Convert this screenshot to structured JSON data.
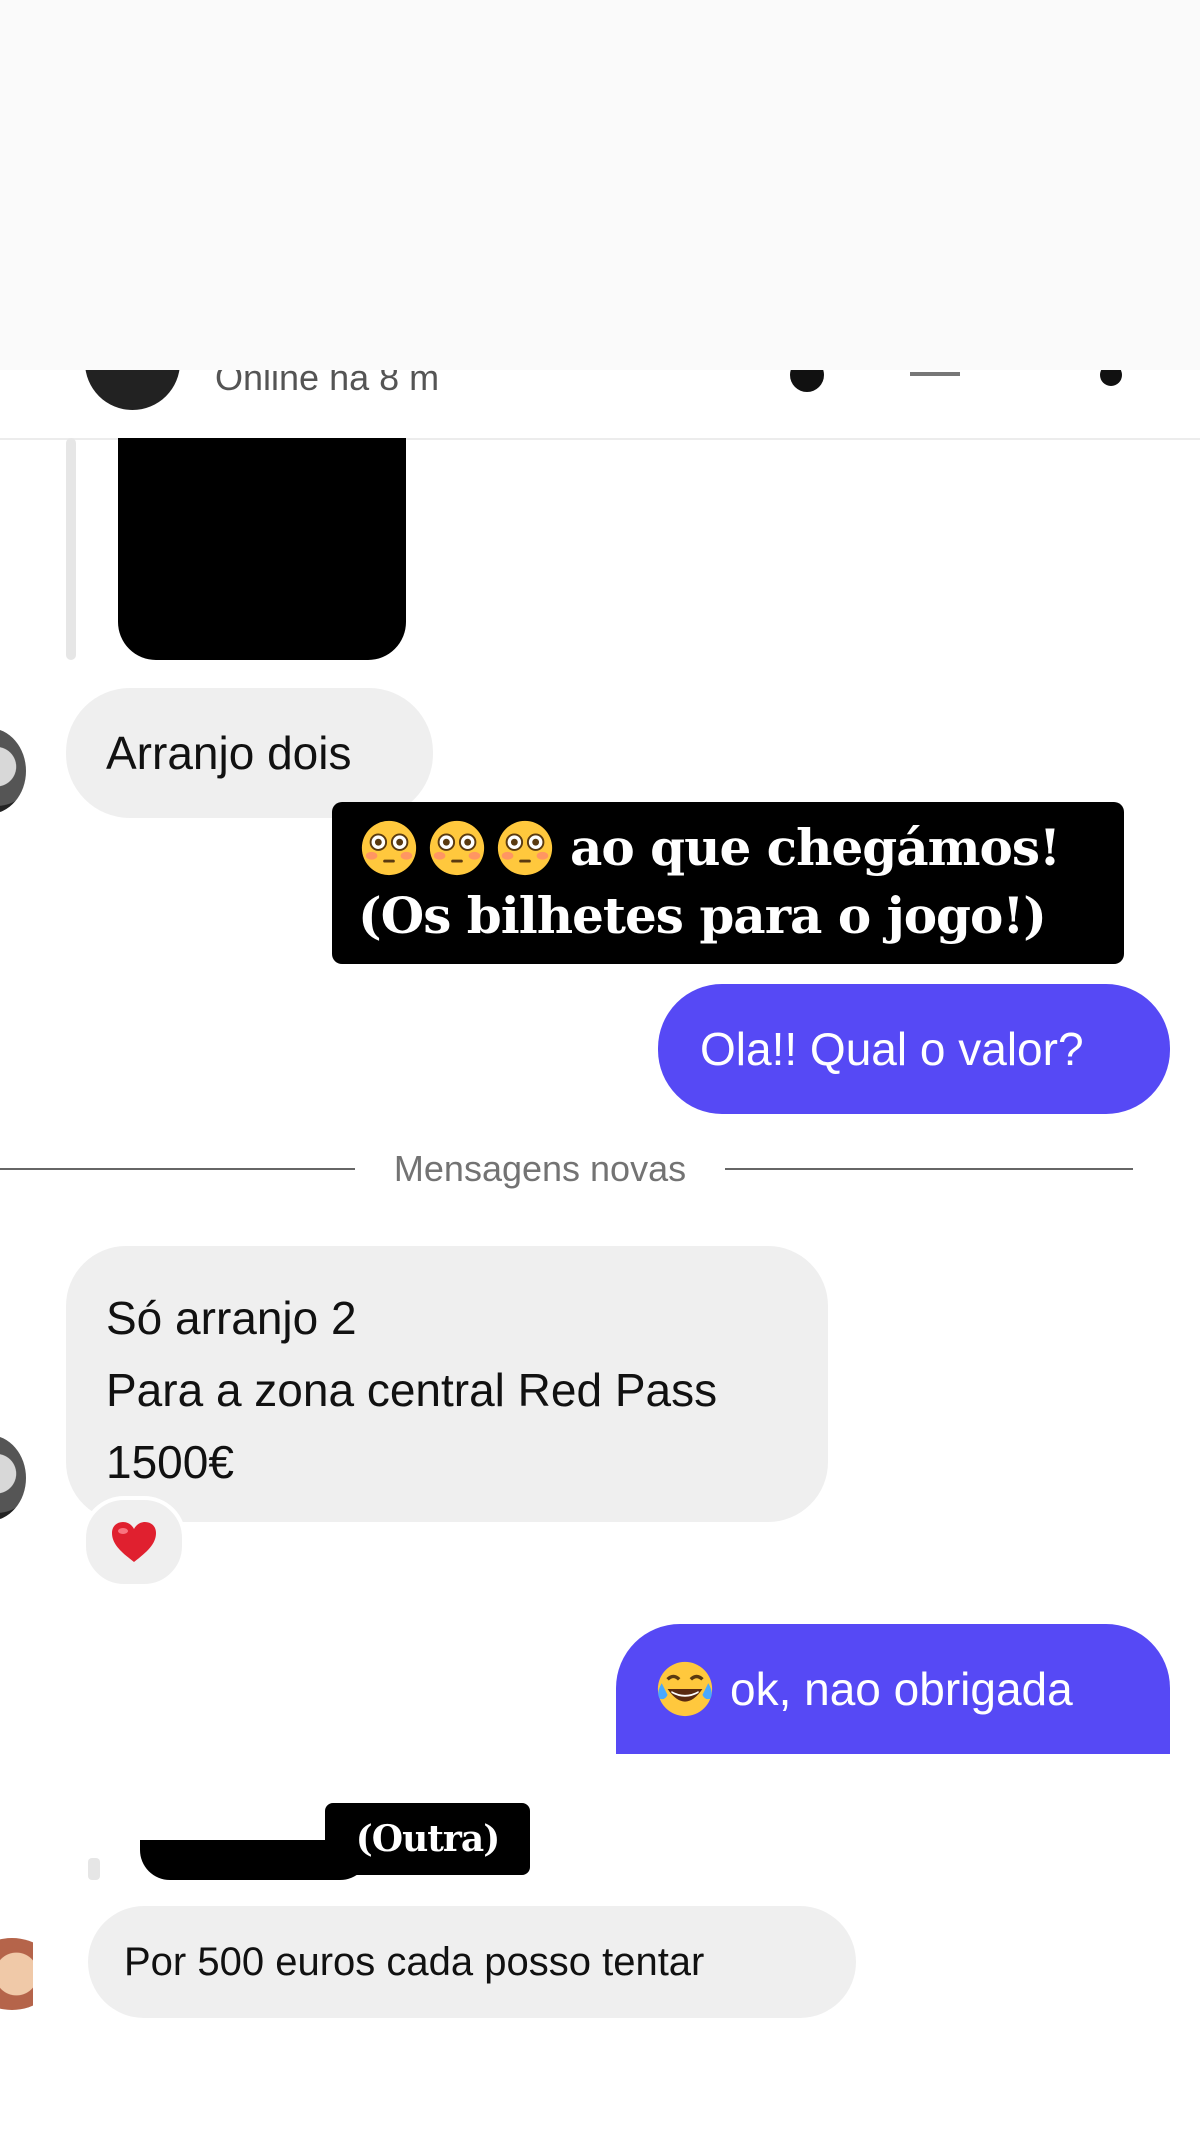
{
  "header": {
    "status": "Online há 8 m"
  },
  "messages": [
    {
      "id": "arranjo",
      "direction": "incoming",
      "text": "Arranjo dois"
    },
    {
      "id": "ola",
      "direction": "outgoing",
      "text": "Ola!! Qual o valor?"
    },
    {
      "id": "so",
      "direction": "incoming",
      "lines": [
        "Só arranjo 2",
        "Para a zona central Red Pass",
        "1500€"
      ],
      "reaction": "heart"
    },
    {
      "id": "ok",
      "direction": "outgoing",
      "emoji": "laughing-tears",
      "text": "ok, nao obrigada"
    },
    {
      "id": "por",
      "direction": "incoming",
      "text": "Por 500 euros cada posso tentar"
    }
  ],
  "divider": {
    "label": "Mensagens novas"
  },
  "overlays": {
    "main_caption": {
      "line1": "ao que chegámos!",
      "line2": "(Os bilhetes para o jogo!)",
      "emoji": "flushed-face",
      "emoji_count": 3
    },
    "second_caption": "(Outra)"
  },
  "colors": {
    "outgoing_bubble": "#5649f5",
    "incoming_bubble": "#efefef",
    "caption_background": "#000000",
    "heart": "#e0202f"
  }
}
